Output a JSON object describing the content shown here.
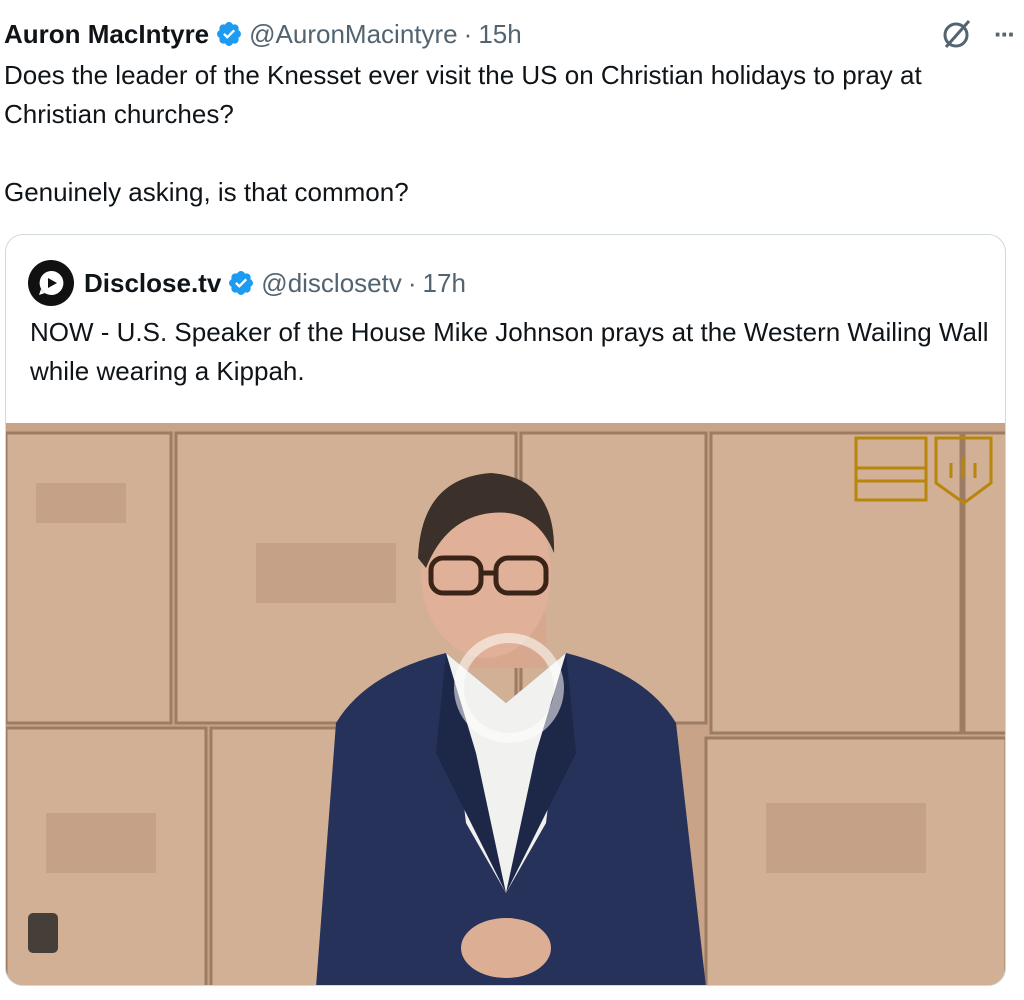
{
  "tweet": {
    "author_name": "Auron MacIntyre",
    "handle": "@AuronMacintyre",
    "separator": "·",
    "time": "15h",
    "text": "Does the leader of the Knesset ever visit the US on Christian holidays to pray at Christian churches?\n\nGenuinely asking, is that common?"
  },
  "header_actions": {
    "grok_icon": "grok-icon",
    "more_icon": "more-icon",
    "more_label": "···"
  },
  "quoted_tweet": {
    "author_name": "Disclose.tv",
    "handle": "@disclosetv",
    "separator": "·",
    "time": "17h",
    "text": "NOW - U.S. Speaker of the House Mike Johnson prays at the Western Wailing Wall while wearing a Kippah."
  },
  "media": {
    "type": "video",
    "play_icon": "play-circle-icon",
    "logo": "knesset-emblem"
  },
  "colors": {
    "verified": "#1d9bf0",
    "secondary_text": "#536471",
    "border": "#cfd9de"
  }
}
